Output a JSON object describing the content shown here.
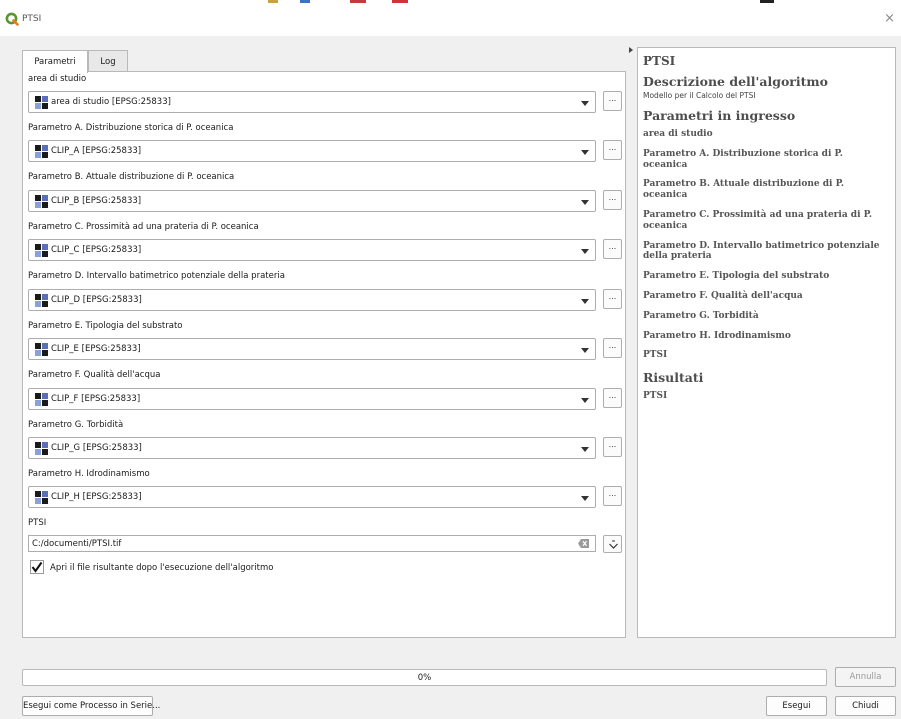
{
  "window": {
    "title": "PTSI",
    "close_glyph": "×"
  },
  "tabs": [
    {
      "label": "Parametri",
      "active": true
    },
    {
      "label": "Log",
      "active": false
    }
  ],
  "params": [
    {
      "label": "area di studio",
      "value": "area di studio [EPSG:25833]"
    },
    {
      "label": "Parametro A. Distribuzione storica di P. oceanica",
      "value": "CLIP_A [EPSG:25833]"
    },
    {
      "label": "Parametro B. Attuale distribuzione di P. oceanica",
      "value": "CLIP_B [EPSG:25833]"
    },
    {
      "label": "Parametro C. Prossimità ad una prateria di P. oceanica",
      "value": "CLIP_C [EPSG:25833]"
    },
    {
      "label": "Parametro D. Intervallo batimetrico potenziale della prateria",
      "value": "CLIP_D [EPSG:25833]"
    },
    {
      "label": "Parametro E. Tipologia del substrato",
      "value": "CLIP_E [EPSG:25833]"
    },
    {
      "label": "Parametro F. Qualità dell'acqua",
      "value": "CLIP_F [EPSG:25833]"
    },
    {
      "label": "Parametro G. Torbidità",
      "value": "CLIP_G [EPSG:25833]"
    },
    {
      "label": "Parametro H. Idrodinamismo",
      "value": "CLIP_H [EPSG:25833]"
    }
  ],
  "dots_label": "...",
  "output": {
    "label": "PTSI",
    "value": "C:/documenti/PTSI.tif",
    "open_checkbox_label": "Apri il file risultante dopo l'esecuzione dell'algoritmo",
    "open_checked": true
  },
  "help": {
    "title": "PTSI",
    "desc_heading": "Descrizione dell'algoritmo",
    "desc": "Modello per il Calcolo del PTSI",
    "inputs_heading": "Parametri in ingresso",
    "inputs": [
      "area di studio",
      "Parametro A. Distribuzione storica di P. oceanica",
      "Parametro B. Attuale distribuzione di P. oceanica",
      "Parametro C. Prossimità ad una prateria di P. oceanica",
      "Parametro D. Intervallo batimetrico potenziale della prateria",
      "Parametro E. Tipologia del substrato",
      "Parametro F. Qualità dell'acqua",
      "Parametro G. Torbidità",
      "Parametro H. Idrodinamismo",
      "PTSI"
    ],
    "outputs_heading": "Risultati",
    "outputs": [
      "PTSI"
    ]
  },
  "progress": {
    "value": 0,
    "text": "0%"
  },
  "buttons": {
    "cancel": "Annulla",
    "batch": "Esegui come Processo in Serie...",
    "run": "Esegui",
    "close": "Chiudi"
  },
  "icons": {
    "app": "qgis-logo-icon",
    "layer": "raster-layer-icon",
    "clear": "clear-field-icon",
    "output_menu": "output-options-icon",
    "check": "checkmark-icon"
  },
  "colors": {
    "qgis_green": "#589632",
    "progress_fill": "#3c8ddc"
  }
}
